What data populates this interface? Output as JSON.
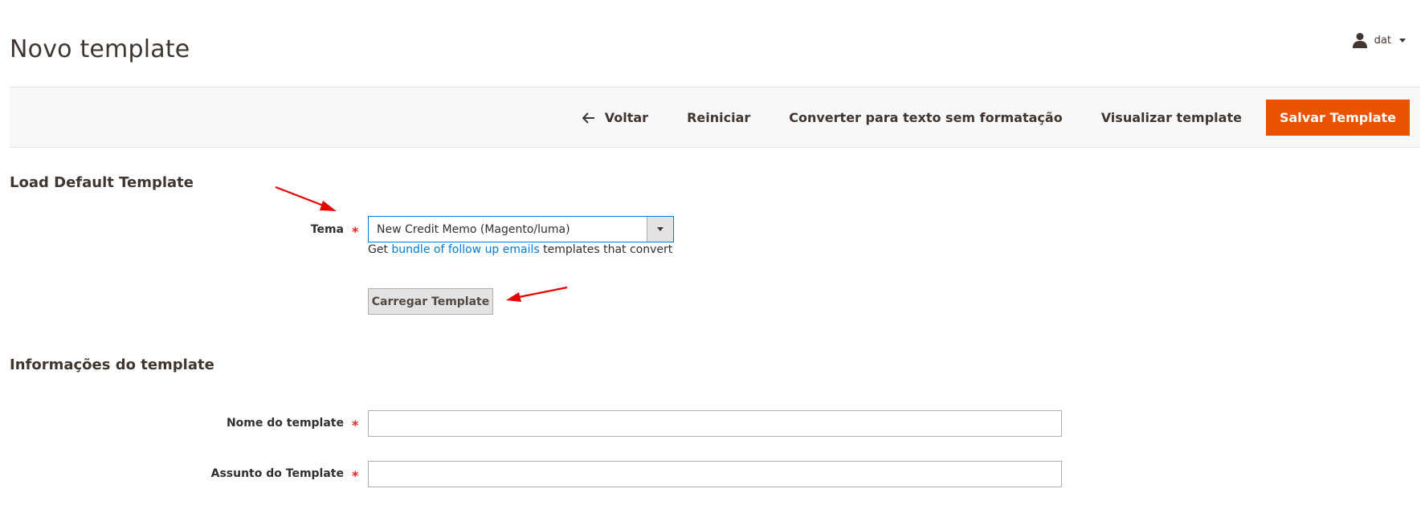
{
  "header": {
    "page_title": "Novo template",
    "user_name": "dat"
  },
  "actions": {
    "back_label": "Voltar",
    "reset_label": "Reiniciar",
    "convert_label": "Converter para texto sem formatação",
    "preview_label": "Visualizar template",
    "save_label": "Salvar Template"
  },
  "load_default": {
    "section_title": "Load Default Template",
    "theme_label": "Tema",
    "theme_required_mark": "*",
    "theme_selected": "New Credit Memo (Magento/luma)",
    "note_prefix": "Get ",
    "note_link": "bundle of follow up emails",
    "note_suffix": " templates that convert",
    "load_button_label": "Carregar Template"
  },
  "template_info": {
    "section_title": "Informações do template",
    "name_label": "Nome do template",
    "name_required_mark": "*",
    "name_value": "",
    "subject_label": "Assunto do Template",
    "subject_required_mark": "*",
    "subject_value": ""
  },
  "colors": {
    "primary_button": "#eb5202",
    "link": "#007bdb",
    "required": "#e22626",
    "annotation_arrow": "#e60000"
  },
  "icons": {
    "user": "user-icon",
    "back": "arrow-left-icon",
    "dropdown": "chevron-down-icon"
  }
}
